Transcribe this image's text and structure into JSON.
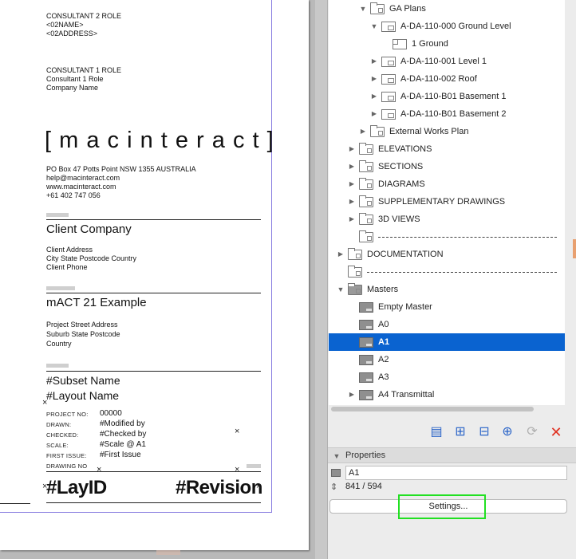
{
  "sheet": {
    "consultant2": {
      "role": "CONSULTANT 2 ROLE",
      "name": "<02NAME>",
      "address": "<02ADDRESS>"
    },
    "consultant1": {
      "role": "CONSULTANT 1 ROLE",
      "name": "Consultant 1 Role",
      "company": "Company Name"
    },
    "logo_text": "[ m a c i n t e r a c t ]",
    "company_info": [
      "PO Box 47 Potts Point NSW 1355 AUSTRALIA",
      "help@macinteract.com",
      "www.macinteract.com",
      "+61 402 747 056"
    ],
    "client": {
      "title": "Client Company",
      "address": "Client Address",
      "city": "City State Postcode Country",
      "phone": "Client Phone"
    },
    "project": {
      "title": "mACT 21 Example",
      "street": "Project Street Address",
      "suburb": "Suburb State Postcode",
      "country": "Country"
    },
    "subset_name": "#Subset Name",
    "layout_name": "#Layout Name",
    "fields": [
      {
        "label": "PROJECT NO:",
        "value": "00000"
      },
      {
        "label": "DRAWN:",
        "value": "#Modified by"
      },
      {
        "label": "CHECKED:",
        "value": "#Checked by"
      },
      {
        "label": "SCALE:",
        "value": "#Scale @ A1"
      },
      {
        "label": "FIRST ISSUE:",
        "value": "#First Issue"
      },
      {
        "label": "DRAWING NO",
        "value": ""
      }
    ],
    "lay_id": "#LayID",
    "revision": "#Revision",
    "x_mark": "×"
  },
  "tree": {
    "rows": [
      {
        "label": "GA Plans",
        "indent": 3,
        "icon": "folder-icon",
        "toggle": "expanded"
      },
      {
        "label": "A-DA-110-000 Ground Level",
        "indent": 4,
        "icon": "layout-icon",
        "toggle": "expanded"
      },
      {
        "label": "1 Ground",
        "indent": 5,
        "icon": "view-icon",
        "toggle": "none"
      },
      {
        "label": "A-DA-110-001 Level 1",
        "indent": 4,
        "icon": "layout-icon",
        "toggle": "collapsed"
      },
      {
        "label": "A-DA-110-002 Roof",
        "indent": 4,
        "icon": "layout-icon",
        "toggle": "collapsed"
      },
      {
        "label": "A-DA-110-B01 Basement 1",
        "indent": 4,
        "icon": "layout-icon",
        "toggle": "collapsed"
      },
      {
        "label": "A-DA-110-B01 Basement 2",
        "indent": 4,
        "icon": "layout-icon",
        "toggle": "collapsed"
      },
      {
        "label": "External Works Plan",
        "indent": 3,
        "icon": "folder-icon",
        "toggle": "collapsed"
      },
      {
        "label": "ELEVATIONS",
        "indent": 2,
        "icon": "folder-icon",
        "toggle": "collapsed"
      },
      {
        "label": "SECTIONS",
        "indent": 2,
        "icon": "folder-icon",
        "toggle": "collapsed"
      },
      {
        "label": "DIAGRAMS",
        "indent": 2,
        "icon": "folder-icon",
        "toggle": "collapsed"
      },
      {
        "label": "SUPPLEMENTARY DRAWINGS",
        "indent": 2,
        "icon": "folder-icon",
        "toggle": "collapsed"
      },
      {
        "label": "3D VIEWS",
        "indent": 2,
        "icon": "folder-icon",
        "toggle": "collapsed"
      },
      {
        "label": "",
        "indent": 2,
        "icon": "folder-icon",
        "toggle": "none",
        "separator": true
      },
      {
        "label": "DOCUMENTATION",
        "indent": 1,
        "icon": "folder-icon",
        "toggle": "collapsed"
      },
      {
        "label": "",
        "indent": 1,
        "icon": "folder-icon",
        "toggle": "none",
        "separator": true
      },
      {
        "label": "Masters",
        "indent": 1,
        "icon": "master-folder-icon",
        "toggle": "expanded"
      },
      {
        "label": "Empty Master",
        "indent": 2,
        "icon": "master-icon",
        "toggle": "none"
      },
      {
        "label": "A0",
        "indent": 2,
        "icon": "master-icon",
        "toggle": "none"
      },
      {
        "label": "A1",
        "indent": 2,
        "icon": "master-icon",
        "toggle": "none",
        "selected": true
      },
      {
        "label": "A2",
        "indent": 2,
        "icon": "master-icon",
        "toggle": "none"
      },
      {
        "label": "A3",
        "indent": 2,
        "icon": "master-icon",
        "toggle": "none"
      },
      {
        "label": "A4 Transmittal",
        "indent": 2,
        "icon": "master-icon",
        "toggle": "collapsed"
      }
    ]
  },
  "toolbar": {
    "buttons": [
      {
        "name": "new-layout-button",
        "icon": "new-layout-icon"
      },
      {
        "name": "new-subset-button",
        "icon": "new-subset-icon"
      },
      {
        "name": "new-master-button",
        "icon": "new-master-icon"
      },
      {
        "name": "new-folder-button",
        "icon": "new-folder-icon"
      },
      {
        "name": "update-button",
        "icon": "refresh-icon"
      },
      {
        "name": "delete-button",
        "icon": "close-icon"
      }
    ]
  },
  "properties": {
    "title": "Properties",
    "name_value": "A1",
    "size_value": "841 / 594",
    "settings_label": "Settings..."
  },
  "colors": {
    "selection": "#0a63d0",
    "highlight": "#22e022",
    "frame": "#8a7fe0"
  }
}
